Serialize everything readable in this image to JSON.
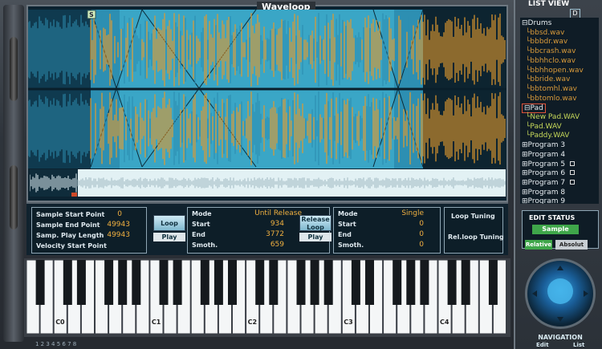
{
  "wave": {
    "title": "Waveloop",
    "marker": "S"
  },
  "params": {
    "sample": {
      "start_label": "Sample Start Point",
      "start_value": "0",
      "end_label": "Sample End Point",
      "end_value": "49943",
      "play_length_label": "Samp. Play Length",
      "play_length_value": "49943",
      "velocity_label": "Velocity Start Point"
    },
    "loop": {
      "loop_button": "Loop",
      "play_button": "Play",
      "mode_label": "Mode",
      "mode_value": "Until Release",
      "start_label": "Start",
      "start_value": "934",
      "end_label": "End",
      "end_value": "3772",
      "smooth_label": "Smoth.",
      "smooth_value": "659"
    },
    "release": {
      "release_button_1": "Release",
      "release_button_2": "Loop",
      "play_button": "Play",
      "mode_label": "Mode",
      "mode_value": "Single",
      "start_label": "Start",
      "start_value": "0",
      "end_label": "End",
      "end_value": "0",
      "smooth_label": "Smoth.",
      "smooth_value": "0"
    },
    "tuning": {
      "loop_tuning": "Loop Tuning",
      "rel_loop_tuning": "Rel.loop Tuning"
    }
  },
  "keyboard": {
    "octave_labels": [
      "C0",
      "C1",
      "C2",
      "C3",
      "C4"
    ]
  },
  "status_strip": {
    "numbers": "1 2 3 4 5 6 7 8"
  },
  "list_view": {
    "title": "LIST VIEW",
    "icon": "D",
    "items": [
      {
        "label": "Drums",
        "kind": "folder",
        "open": true
      },
      {
        "label": "bbsd.wav",
        "kind": "sample"
      },
      {
        "label": "bbbdr.wav",
        "kind": "sample"
      },
      {
        "label": "bbcrash.wav",
        "kind": "sample"
      },
      {
        "label": "bbhhclo.wav",
        "kind": "sample"
      },
      {
        "label": "bbhhopen.wav",
        "kind": "sample"
      },
      {
        "label": "bbride.wav",
        "kind": "sample"
      },
      {
        "label": "bbtomhl.wav",
        "kind": "sample"
      },
      {
        "label": "bbtomlo.wav",
        "kind": "sample"
      },
      {
        "label": "Pad",
        "kind": "folder",
        "open": true,
        "selected": true
      },
      {
        "label": "New Pad.WAV",
        "kind": "sample-pad"
      },
      {
        "label": "Pad.WAV",
        "kind": "sample-pad"
      },
      {
        "label": "Paddy.WAV",
        "kind": "sample-pad"
      },
      {
        "label": "Program 3",
        "kind": "program"
      },
      {
        "label": "Program 4",
        "kind": "program"
      },
      {
        "label": "Program 5",
        "kind": "program"
      },
      {
        "label": "Program 6",
        "kind": "program"
      },
      {
        "label": "Program 7",
        "kind": "program"
      },
      {
        "label": "Program 8",
        "kind": "program"
      },
      {
        "label": "Program 9",
        "kind": "program"
      }
    ]
  },
  "edit_status": {
    "title": "EDIT STATUS",
    "sample": "Sample",
    "relative": "Relative",
    "absolute": "Absolut"
  },
  "navigation": {
    "title": "NAVIGATION",
    "edit": "Edit",
    "list": "List"
  },
  "colors": {
    "wave_orange": "#e29a2e",
    "wave_teal": "#2d8fb2",
    "loop_region": "#5ac4dc",
    "accent_green": "#3fa64a"
  }
}
